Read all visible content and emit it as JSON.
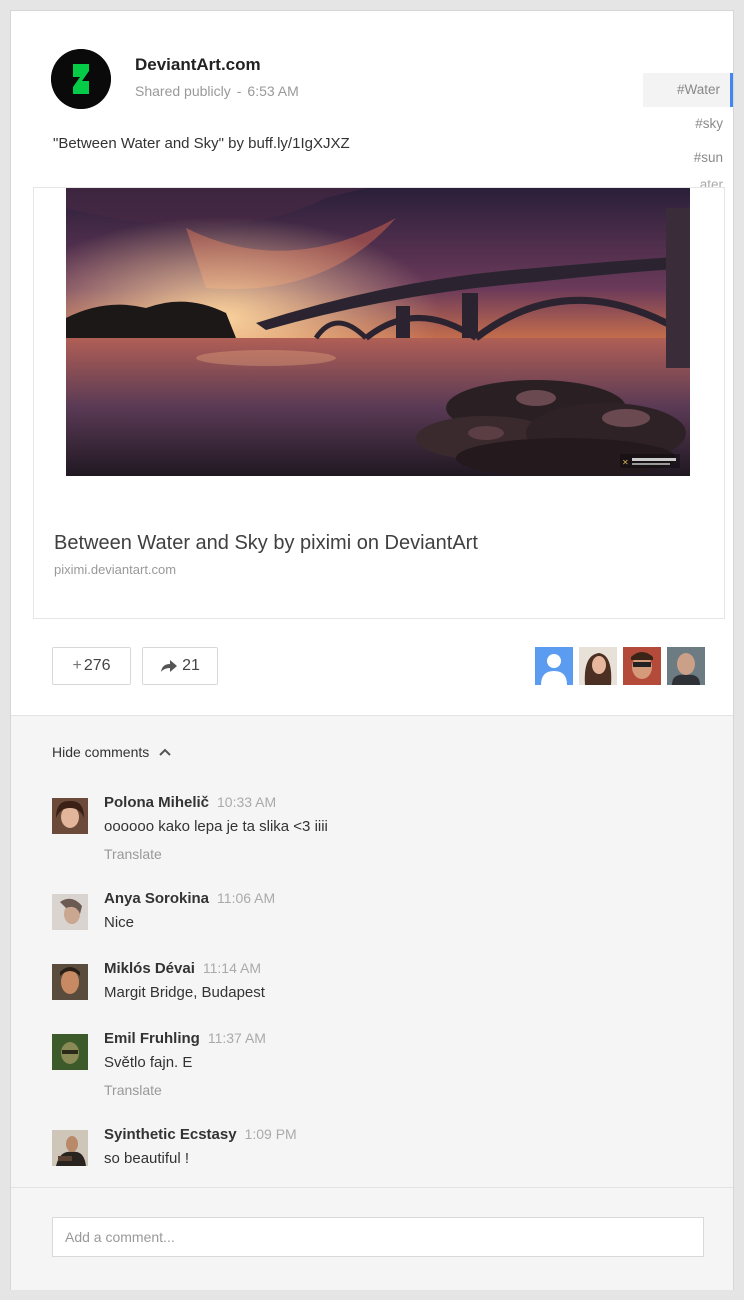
{
  "post": {
    "author": "DeviantArt.com",
    "visibility": "Shared publicly",
    "separator": "-",
    "time": "6:53 AM",
    "caption": "\"Between Water and Sky\" by buff.ly/1IgXJXZ",
    "hashtags": [
      "#Water",
      "#sky",
      "#sun",
      "ater"
    ]
  },
  "link_card": {
    "title": "Between Water and Sky by piximi on DeviantArt",
    "domain": "piximi.deviantart.com",
    "image_icon": "bridge-sunset-photo",
    "watermark_icon": "photographer-watermark"
  },
  "actions": {
    "plus_symbol": "+",
    "plus_count": "276",
    "share_count": "21",
    "plusser_icons": [
      "default-avatar-icon",
      "user-avatar-photo",
      "user-avatar-photo",
      "user-avatar-photo"
    ]
  },
  "comments_section": {
    "toggle_label": "Hide comments",
    "comments": [
      {
        "name": "Polona Mihelič",
        "time": "10:33 AM",
        "text": "oooooo kako lepa je ta slika <3 iiii",
        "translate": "Translate"
      },
      {
        "name": "Anya Sorokina",
        "time": "11:06 AM",
        "text": "Nice",
        "translate": ""
      },
      {
        "name": "Miklós Dévai",
        "time": "11:14 AM",
        "text": "Margit Bridge, Budapest",
        "translate": ""
      },
      {
        "name": "Emil Fruhling",
        "time": "11:37 AM",
        "text": "Světlo fajn. E",
        "translate": "Translate"
      },
      {
        "name": "Syinthetic Ecstasy",
        "time": "1:09 PM",
        "text": "so beautiful !",
        "translate": ""
      }
    ]
  },
  "add_comment": {
    "placeholder": "Add a comment..."
  },
  "colors": {
    "accent": "#4285f4",
    "brand_green": "#05cc47",
    "avatar_bg": "#0a0a0a"
  }
}
